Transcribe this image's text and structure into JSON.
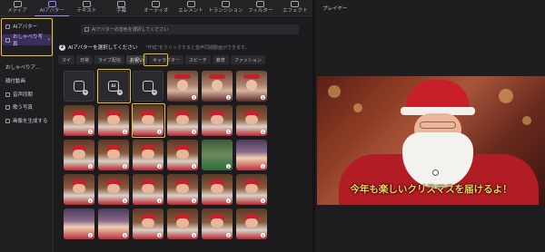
{
  "toolbar": {
    "items": [
      {
        "label": "メディア",
        "icon": "media-icon"
      },
      {
        "label": "AIアバター",
        "icon": "ai-avatar-icon"
      },
      {
        "label": "テキスト",
        "icon": "text-icon"
      },
      {
        "label": "字幕",
        "icon": "subtitle-icon"
      },
      {
        "label": "オーディオ",
        "icon": "audio-icon"
      },
      {
        "label": "エレメント",
        "icon": "element-icon"
      },
      {
        "label": "トランジション",
        "icon": "transition-icon"
      },
      {
        "label": "フィルター",
        "icon": "filter-icon"
      },
      {
        "label": "エフェクト",
        "icon": "effect-icon"
      }
    ],
    "active_index": 1
  },
  "sidebar": {
    "items": [
      {
        "label": "AIアバター",
        "selected": false
      },
      {
        "label": "おしゃべり写真",
        "selected": true
      },
      {
        "label": "おしゃべりア...",
        "selected": false
      },
      {
        "label": "顔付動画",
        "selected": false
      },
      {
        "label": "音声同期",
        "selected": false
      },
      {
        "label": "歌う写真",
        "selected": false
      },
      {
        "label": "画像を生成する",
        "selected": false
      }
    ]
  },
  "content": {
    "notice": "AIアバターの音色を選択してください",
    "step_number": "2",
    "step_title": "AIアバターを選択してください",
    "step_hint": "\"作成\"をクリックすると音声同期動画ができます。",
    "tabs": [
      "マイ",
      "日常",
      "ライブ配信",
      "お祝い",
      "キャラクター",
      "スピーチ",
      "教育",
      "ファッション"
    ],
    "active_tab_index": 3,
    "special_cells": [
      {
        "name": "upload-photo",
        "text": ""
      },
      {
        "name": "ai-generate",
        "text": "AI"
      },
      {
        "name": "video-avatar",
        "text": ""
      }
    ]
  },
  "player": {
    "title": "プレイヤー",
    "subtitle_text": "今年も楽しいクリスマスを届けるよ！"
  },
  "colors": {
    "accent": "#a78bfa",
    "highlight": "#f2c21b",
    "subtitle": "#f3d35a"
  }
}
